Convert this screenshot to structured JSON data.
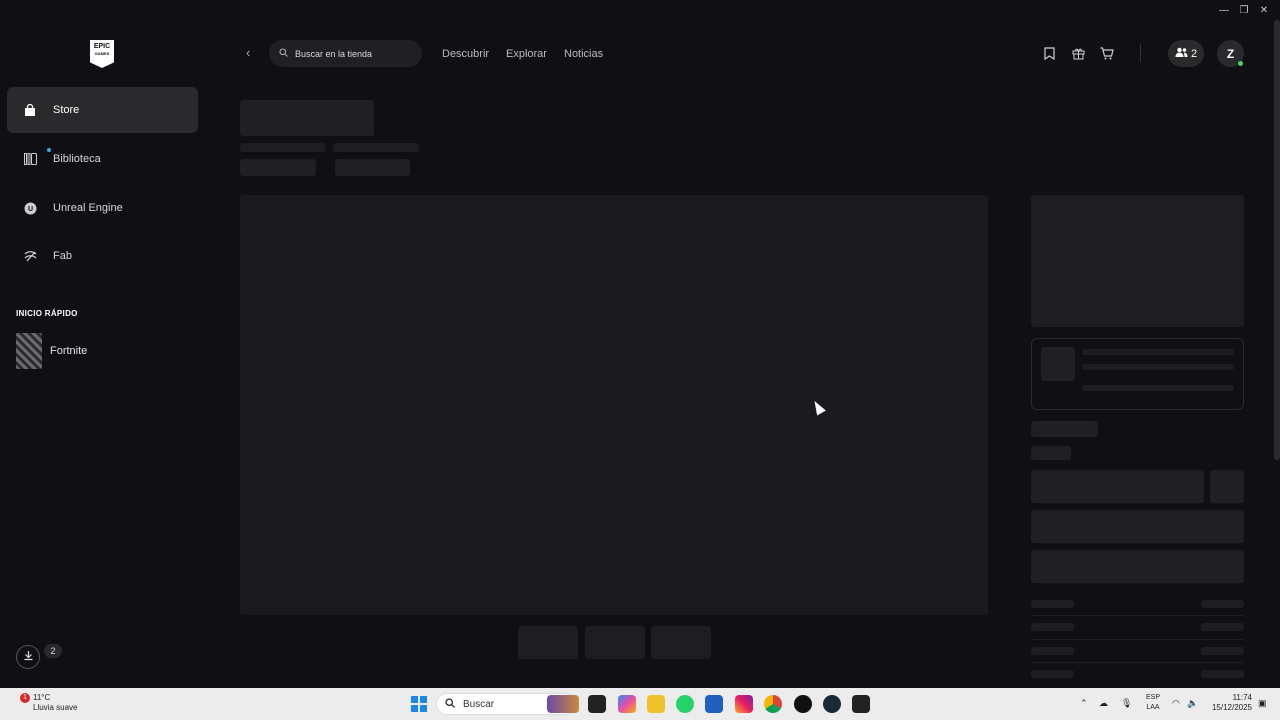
{
  "window": {
    "minimize": "—",
    "restore": "❐",
    "close": "✕"
  },
  "logo": {
    "line1": "EPIC",
    "line2": "GAMES"
  },
  "sidebar": {
    "items": [
      {
        "label": "Store",
        "icon": "shopping-bag-icon"
      },
      {
        "label": "Biblioteca",
        "icon": "library-icon"
      },
      {
        "label": "Unreal Engine",
        "icon": "unreal-engine-icon"
      },
      {
        "label": "Fab",
        "icon": "fab-icon"
      }
    ],
    "quick_launch_title": "INICIO RÁPIDO",
    "quick_launch": [
      {
        "label": "Fortnite"
      }
    ],
    "downloads_count": "2"
  },
  "header": {
    "search_placeholder": "Buscar en la tienda",
    "nav": [
      "Descubrir",
      "Explorar",
      "Noticias"
    ],
    "friends_count": "2",
    "avatar_initial": "Z"
  },
  "taskbar": {
    "weather_temp": "11°C",
    "weather_desc": "Lluvia suave",
    "weather_alert": "1",
    "search_label": "Buscar",
    "lang_1": "ESP",
    "lang_2": "LAA",
    "time": "11:74",
    "date": "15/12/2025"
  },
  "colors": {
    "background": "#101014",
    "active_nav": "#2a2a2d",
    "skeleton": "#1e1e22",
    "notification_dot": "#3ca6e8"
  }
}
